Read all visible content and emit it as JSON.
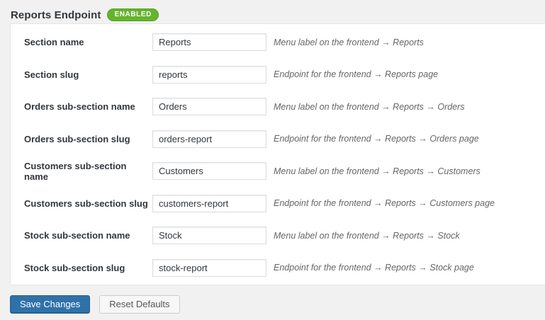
{
  "header": {
    "title": "Reports Endpoint",
    "badge": "ENABLED"
  },
  "colors": {
    "badge_green": "#64b42d",
    "primary_button_blue": "#2f71a9",
    "page_background": "#f1f1f1",
    "panel_background": "#ffffff",
    "description_gray": "#666666"
  },
  "rows": [
    {
      "label": "Section name",
      "value": "Reports",
      "description": "Menu label on the frontend → Reports"
    },
    {
      "label": "Section slug",
      "value": "reports",
      "description": "Endpoint for the frontend → Reports page"
    },
    {
      "label": "Orders sub-section name",
      "value": "Orders",
      "description": "Menu label on the frontend → Reports → Orders"
    },
    {
      "label": "Orders sub-section slug",
      "value": "orders-report",
      "description": "Endpoint for the frontend → Reports → Orders page"
    },
    {
      "label": "Customers sub-section name",
      "value": "Customers",
      "description": "Menu label on the frontend → Reports → Customers"
    },
    {
      "label": "Customers sub-section slug",
      "value": "customers-report",
      "description": "Endpoint for the frontend → Reports → Customers page"
    },
    {
      "label": "Stock sub-section name",
      "value": "Stock",
      "description": "Menu label on the frontend → Reports → Stock"
    },
    {
      "label": "Stock sub-section slug",
      "value": "stock-report",
      "description": "Endpoint for the frontend → Reports → Stock page"
    }
  ],
  "actions": {
    "save_label": "Save Changes",
    "reset_label": "Reset Defaults"
  }
}
